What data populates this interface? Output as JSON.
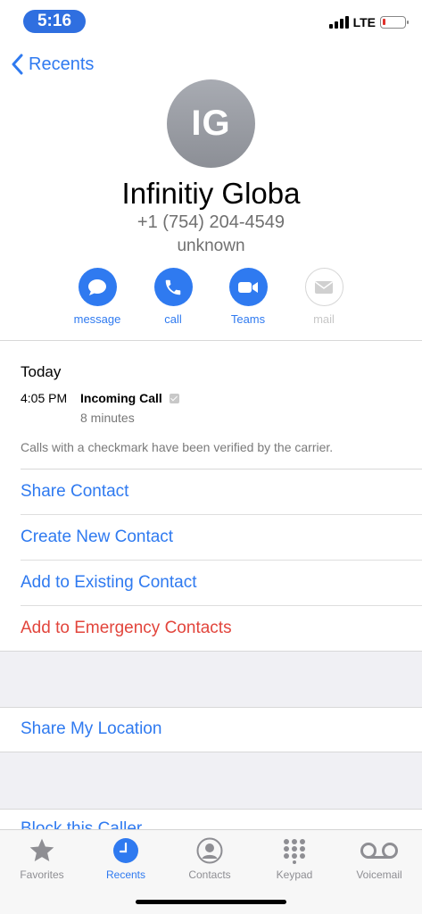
{
  "status_bar": {
    "time": "5:16",
    "network": "LTE",
    "battery_color": "#e0312b"
  },
  "nav": {
    "back_label": "Recents"
  },
  "contact": {
    "initials": "IG",
    "name": "Infinitiy Globa",
    "phone": "+1 (754) 204-4549",
    "label": "unknown"
  },
  "actions": [
    {
      "label": "message",
      "icon": "message-bubble-icon",
      "enabled": true
    },
    {
      "label": "call",
      "icon": "phone-icon",
      "enabled": true
    },
    {
      "label": "Teams",
      "icon": "video-camera-icon",
      "enabled": true
    },
    {
      "label": "mail",
      "icon": "envelope-icon",
      "enabled": false
    }
  ],
  "recents": {
    "title": "Today",
    "entries": [
      {
        "time": "4:05 PM",
        "type": "Incoming Call",
        "verified": true,
        "duration": "8 minutes"
      }
    ],
    "note": "Calls with a checkmark have been verified by the carrier."
  },
  "options": {
    "share_contact": "Share Contact",
    "create_new_contact": "Create New Contact",
    "add_to_existing_contact": "Add to Existing Contact",
    "add_to_emergency_contacts": "Add to Emergency Contacts",
    "share_my_location": "Share My Location",
    "block_this_caller": "Block this Caller"
  },
  "tab_bar": {
    "tabs": [
      {
        "label": "Favorites",
        "icon": "star-icon",
        "active": false
      },
      {
        "label": "Recents",
        "icon": "clock-icon",
        "active": true
      },
      {
        "label": "Contacts",
        "icon": "person-circle-icon",
        "active": false
      },
      {
        "label": "Keypad",
        "icon": "keypad-icon",
        "active": false
      },
      {
        "label": "Voicemail",
        "icon": "voicemail-icon",
        "active": false
      }
    ]
  },
  "colors": {
    "accent": "#2f7af0",
    "destructive": "#e2453c",
    "secondary_text": "#707070"
  }
}
